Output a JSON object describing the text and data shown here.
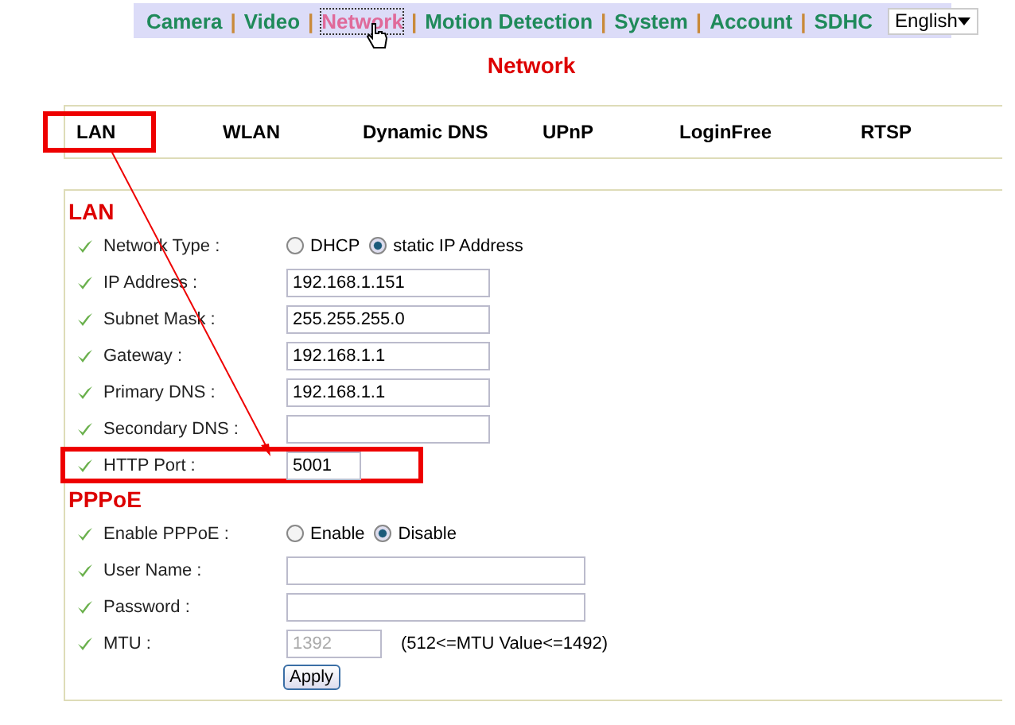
{
  "nav": {
    "links": [
      {
        "label": "Camera",
        "selected": false
      },
      {
        "label": "Video",
        "selected": false
      },
      {
        "label": "Network",
        "selected": true
      },
      {
        "label": "Motion Detection",
        "selected": false
      },
      {
        "label": "System",
        "selected": false
      },
      {
        "label": "Account",
        "selected": false
      },
      {
        "label": "SDHC",
        "selected": false
      }
    ],
    "separator": "|",
    "language": "English"
  },
  "title": "Network",
  "tabs": [
    {
      "label": "LAN",
      "annotated": true
    },
    {
      "label": "WLAN",
      "annotated": false
    },
    {
      "label": "Dynamic DNS",
      "annotated": false
    },
    {
      "label": "UPnP",
      "annotated": false
    },
    {
      "label": "LoginFree",
      "annotated": false
    },
    {
      "label": "RTSP",
      "annotated": false
    }
  ],
  "sections": [
    {
      "heading": "LAN",
      "rows": [
        {
          "label": "Network Type :",
          "kind": "radio",
          "options": [
            {
              "label": "DHCP",
              "selected": false
            },
            {
              "label": "static IP Address",
              "selected": true
            }
          ]
        },
        {
          "label": "IP Address :",
          "kind": "text",
          "value": "192.168.1.151",
          "annotated": false
        },
        {
          "label": "Subnet Mask :",
          "kind": "text",
          "value": "255.255.255.0",
          "annotated": false
        },
        {
          "label": "Gateway :",
          "kind": "text",
          "value": "192.168.1.1",
          "annotated": false
        },
        {
          "label": "Primary DNS :",
          "kind": "text",
          "value": "192.168.1.1",
          "annotated": false
        },
        {
          "label": "Secondary DNS :",
          "kind": "text",
          "annotated": false
        },
        {
          "label": "HTTP Port :",
          "kind": "short",
          "value": "5001",
          "annotated": true
        }
      ]
    },
    {
      "heading": "PPPoE",
      "rows": [
        {
          "label": "Enable PPPoE :",
          "kind": "radio",
          "options": [
            {
              "label": "Enable",
              "selected": false
            },
            {
              "label": "Disable",
              "selected": true
            }
          ]
        },
        {
          "label": "User Name :",
          "kind": "wide",
          "annotated": false
        },
        {
          "label": "Password :",
          "kind": "wide",
          "annotated": false
        },
        {
          "label": "MTU :",
          "kind": "number",
          "value": "1392",
          "disabled": true,
          "hint": "(512<=MTU Value<=1492)",
          "annotated": false
        }
      ]
    }
  ],
  "apply": "Apply"
}
